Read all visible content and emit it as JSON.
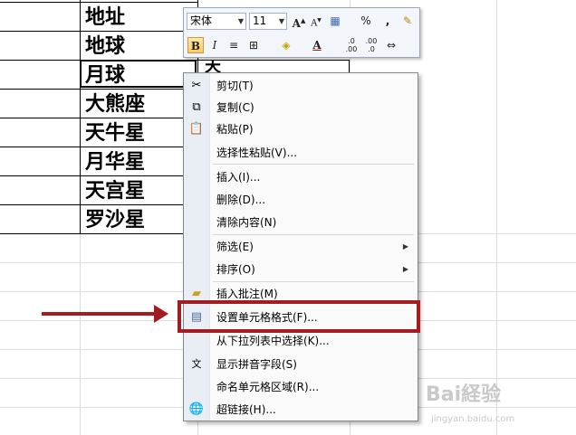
{
  "sheet": {
    "cells": [
      "地址",
      "地球",
      "月球",
      "大熊座",
      "天牛星",
      "月华星",
      "天宫星",
      "罗沙星"
    ],
    "partial_cell_text": "天"
  },
  "mini_toolbar": {
    "font_name": "宋体",
    "font_size": "11",
    "percent_label": "%",
    "comma_label": ",",
    "bold_label": "B",
    "italic_label": "I",
    "font_color_label": "A"
  },
  "context_menu": {
    "items": [
      {
        "label": "剪切(T)",
        "icon": "scissors-icon"
      },
      {
        "label": "复制(C)",
        "icon": "copy-icon"
      },
      {
        "label": "粘贴(P)",
        "icon": "paste-icon"
      },
      {
        "label": "选择性粘贴(V)..."
      },
      {
        "label": "插入(I)..."
      },
      {
        "label": "删除(D)..."
      },
      {
        "label": "清除内容(N)"
      },
      {
        "label": "筛选(E)",
        "submenu": true
      },
      {
        "label": "排序(O)",
        "submenu": true
      },
      {
        "label": "插入批注(M)",
        "icon": "comment-icon"
      },
      {
        "label": "设置单元格格式(F)...",
        "icon": "format-cells-icon"
      },
      {
        "label": "从下拉列表中选择(K)..."
      },
      {
        "label": "显示拼音字段(S)",
        "icon": "pinyin-icon"
      },
      {
        "label": "命名单元格区域(R)..."
      },
      {
        "label": "超链接(H)...",
        "icon": "hyperlink-icon"
      }
    ]
  },
  "annotation": {
    "color": "#a11d22"
  },
  "watermark": {
    "main": "Bai経验",
    "sub": "jingyan.baidu.com"
  }
}
